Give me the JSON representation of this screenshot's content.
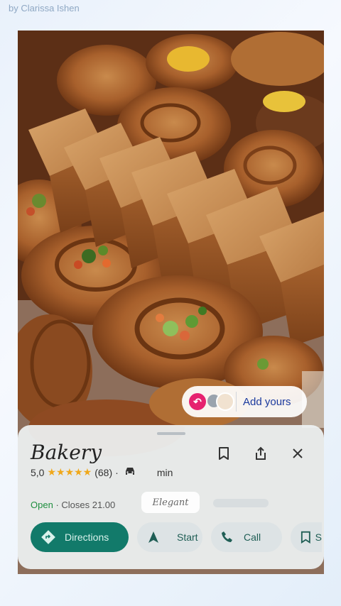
{
  "story": {
    "author": "by Clarissa Ishen"
  },
  "sticker": {
    "label": "Add yours"
  },
  "place": {
    "name": "Bakery",
    "rating": "5,0",
    "review_count": "(68)",
    "separator": "·",
    "travel_time": "min",
    "status": "Open",
    "hours": "· Closes 21.00",
    "chip": "Elegant"
  },
  "actions": {
    "directions": "Directions",
    "start": "Start",
    "call": "Call",
    "save_partial": "S"
  },
  "colors": {
    "primary": "#127a6a",
    "open": "#1e8e3e",
    "star": "#f0a81a",
    "add_yours_text": "#1a3a9e",
    "reply_badge": "#e6226f"
  }
}
